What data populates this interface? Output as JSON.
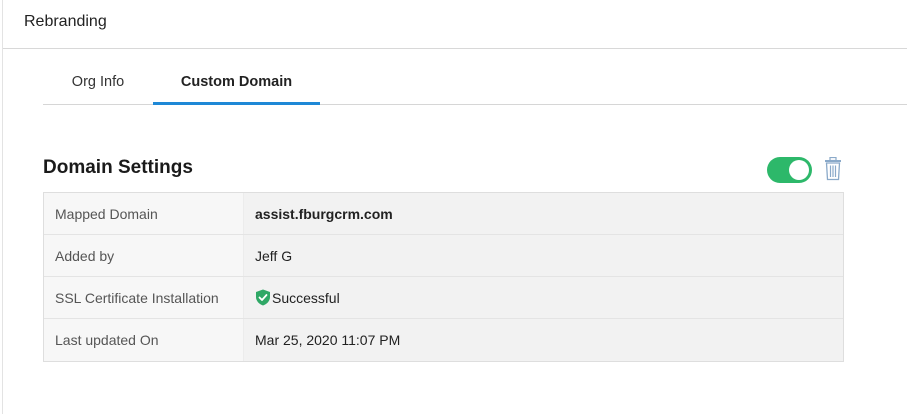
{
  "header": {
    "title": "Rebranding"
  },
  "tabs": [
    {
      "label": "Org Info",
      "active": false
    },
    {
      "label": "Custom Domain",
      "active": true
    }
  ],
  "section": {
    "title": "Domain Settings",
    "enabled": true
  },
  "details": {
    "mapped_domain": {
      "label": "Mapped Domain",
      "value": "assist.fburgcrm.com"
    },
    "added_by": {
      "label": "Added by",
      "value": "Jeff G"
    },
    "ssl": {
      "label": "SSL Certificate Installation",
      "value": "Successful",
      "icon": "shield-check-icon"
    },
    "last_updated": {
      "label": "Last updated On",
      "value": "Mar 25, 2020 11:07 PM"
    }
  },
  "colors": {
    "accent": "#1e88d6",
    "toggle_on": "#2db86a",
    "success": "#2fa866",
    "trash": "#8aa9c9"
  }
}
